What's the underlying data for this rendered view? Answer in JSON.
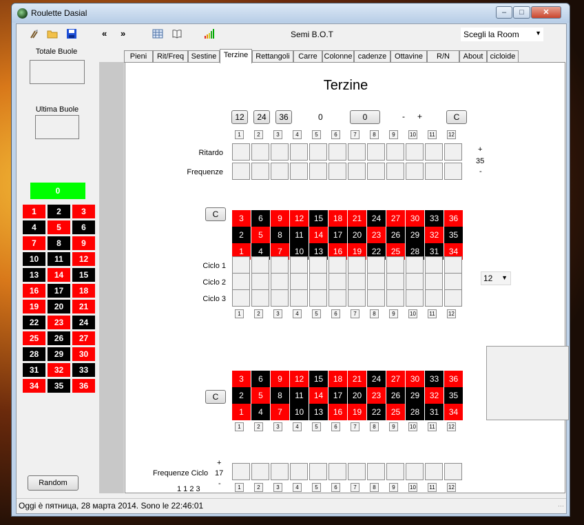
{
  "window": {
    "title": "Roulette Dasial"
  },
  "toolbar": {
    "prev": "«",
    "next": "»",
    "semi_label": "Semi   B.O.T",
    "room": {
      "value": "Scegli la Room",
      "arrow": "▼"
    }
  },
  "left": {
    "totale_label": "Totale Buole",
    "ultima_label": "Ultima Buole",
    "zero": "0",
    "numbers": [
      [
        "1",
        "2",
        "3"
      ],
      [
        "4",
        "5",
        "6"
      ],
      [
        "7",
        "8",
        "9"
      ],
      [
        "10",
        "11",
        "12"
      ],
      [
        "13",
        "14",
        "15"
      ],
      [
        "16",
        "17",
        "18"
      ],
      [
        "19",
        "20",
        "21"
      ],
      [
        "22",
        "23",
        "24"
      ],
      [
        "25",
        "26",
        "27"
      ],
      [
        "28",
        "29",
        "30"
      ],
      [
        "31",
        "32",
        "33"
      ],
      [
        "34",
        "35",
        "36"
      ]
    ],
    "random_button": "Random"
  },
  "tabs": [
    "Pieni",
    "Rit/Freq",
    "Sestine",
    "Terzine",
    "Rettangoli",
    "Carre",
    "Colonne",
    "cadenze",
    "Ottavine",
    "R/N",
    "About",
    "cicloide"
  ],
  "active_tab": "Terzine",
  "page": {
    "title": "Terzine",
    "top_buttons": {
      "b12": "12",
      "b24": "24",
      "b36": "36",
      "value1": "0",
      "value_btn": "0",
      "minus": "-",
      "plus": "+",
      "c": "C"
    },
    "indexes": [
      "1",
      "2",
      "3",
      "4",
      "5",
      "6",
      "7",
      "8",
      "9",
      "10",
      "11",
      "12"
    ],
    "ritardo_label": "Ritardo",
    "frequenze_label": "Frequenze",
    "side_plus": "+",
    "side_value": "35",
    "side_minus": "-",
    "board_c": "C",
    "board": [
      [
        "3",
        "6",
        "9",
        "12",
        "15",
        "18",
        "21",
        "24",
        "27",
        "30",
        "33",
        "36"
      ],
      [
        "2",
        "5",
        "8",
        "11",
        "14",
        "17",
        "20",
        "23",
        "26",
        "29",
        "32",
        "35"
      ],
      [
        "1",
        "4",
        "7",
        "10",
        "13",
        "16",
        "19",
        "22",
        "25",
        "28",
        "31",
        "34"
      ]
    ],
    "ciclo_labels": [
      "Ciclo 1",
      "Ciclo 2",
      "Ciclo 3"
    ],
    "ciclo_combo": {
      "value": "12",
      "arrow": "▼"
    },
    "board2_c": "C",
    "freq_ciclo_label": "Frequenze Ciclo",
    "freq_plus": "+",
    "freq_value": "17",
    "freq_minus": "-",
    "freq_sequence": "1 1 2 3"
  },
  "status": {
    "text": "Oggi è пятница, 28 марта 2014. Sono le 22:46:01"
  },
  "colors": {
    "red": "#ff0000",
    "black": "#000000",
    "green": "#00ff00"
  }
}
